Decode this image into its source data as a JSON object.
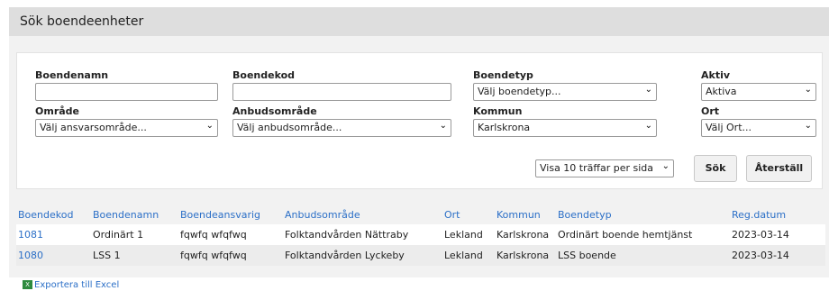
{
  "header": {
    "title": "Sök boendeenheter"
  },
  "form": {
    "boendenamn": {
      "label": "Boendenamn",
      "value": ""
    },
    "boendekod": {
      "label": "Boendekod",
      "value": ""
    },
    "boendetyp": {
      "label": "Boendetyp",
      "selected": "Välj boendetyp..."
    },
    "aktiv": {
      "label": "Aktiv",
      "selected": "Aktiva"
    },
    "omrade": {
      "label": "Område",
      "selected": "Välj ansvarsområde..."
    },
    "anbudsomrade": {
      "label": "Anbudsområde",
      "selected": "Välj anbudsområde..."
    },
    "kommun": {
      "label": "Kommun",
      "selected": "Karlskrona"
    },
    "ort": {
      "label": "Ort",
      "selected": "Välj Ort..."
    },
    "per_page": {
      "selected": "Visa 10 träffar per sida"
    },
    "search_label": "Sök",
    "reset_label": "Återställ"
  },
  "table": {
    "columns": [
      "Boendekod",
      "Boendenamn",
      "Boendeansvarig",
      "Anbudsområde",
      "Ort",
      "Kommun",
      "Boendetyp",
      "Reg.datum"
    ],
    "rows": [
      [
        "1081",
        "Ordinärt 1",
        "fqwfq wfqfwq",
        "Folktandvården Nättraby",
        "Lekland",
        "Karlskrona",
        "Ordinärt boende hemtjänst",
        "2023-03-14"
      ],
      [
        "1080",
        "LSS 1",
        "fqwfq wfqfwq",
        "Folktandvården Lyckeby",
        "Lekland",
        "Karlskrona",
        "LSS boende",
        "2023-03-14"
      ]
    ]
  },
  "export": {
    "icon": "excel-icon",
    "label": "Exportera till Excel"
  },
  "colors": {
    "link": "#2b6fc7",
    "header_bg": "#dedede",
    "panel_bg": "#f2f2f2"
  }
}
